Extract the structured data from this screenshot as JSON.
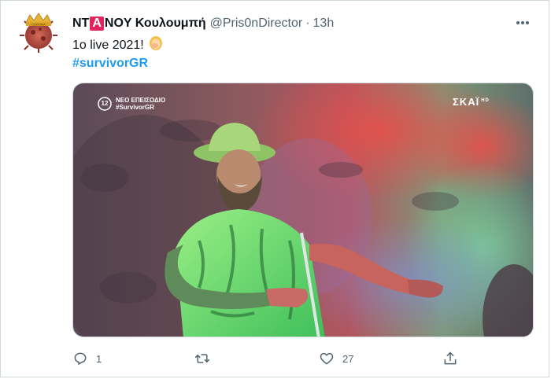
{
  "tweet": {
    "display_name_prefix": "NT",
    "display_name_badge": "A",
    "display_name_suffix": "NOY Κουλουμπή",
    "handle": "@Pris0nDirector",
    "separator": "·",
    "time": "13h",
    "text": "1o live 2021!",
    "hashtag": "#survivorGR",
    "media": {
      "overlay_badge": "12",
      "overlay_line1": "ΝΕΟ ΕΠΕΙΣΟΔΙΟ",
      "overlay_line2": "#SurvivorGR",
      "channel_logo": "ΣΚΑΪ",
      "channel_logo_suffix": "HD"
    },
    "actions": {
      "reply_count": "1",
      "retweet_count": "",
      "like_count": "27"
    }
  },
  "icons": {
    "more": "more-horizontal-icon",
    "reply": "reply-icon",
    "retweet": "retweet-icon",
    "like": "heart-icon",
    "share": "share-icon"
  },
  "colors": {
    "hashtag": "#1d9bf0",
    "secondary_text": "#536471",
    "badge": "#e0245e"
  }
}
